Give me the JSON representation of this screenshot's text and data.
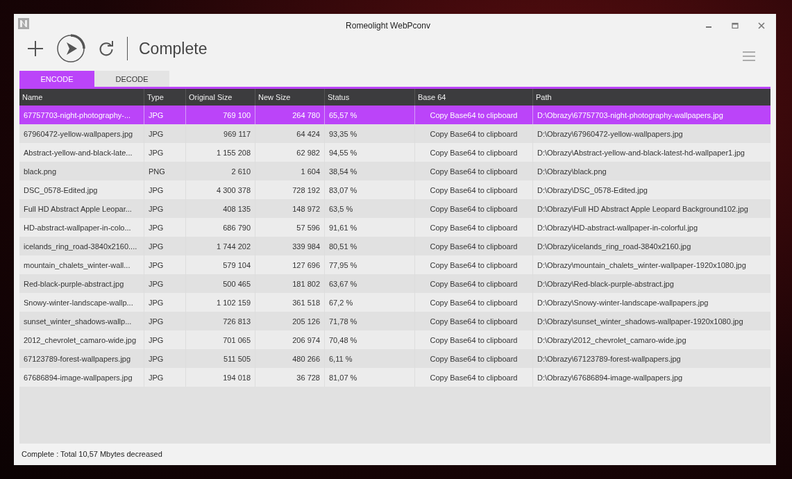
{
  "window": {
    "title": "Romeolight WebPconv"
  },
  "toolbar": {
    "status": "Complete"
  },
  "tabs": [
    {
      "label": "ENCODE",
      "selected": true
    },
    {
      "label": "DECODE",
      "selected": false
    }
  ],
  "table": {
    "columns": [
      "Name",
      "Type",
      "Original Size",
      "New Size",
      "Status",
      "Base 64",
      "Path"
    ],
    "rows": [
      {
        "name": "67757703-night-photography-...",
        "type": "JPG",
        "original_size": "769 100",
        "new_size": "264 780",
        "status": "65,57 %",
        "base64": "Copy Base64 to clipboard",
        "path": "D:\\Obrazy\\67757703-night-photography-wallpapers.jpg",
        "selected": true
      },
      {
        "name": "67960472-yellow-wallpapers.jpg",
        "type": "JPG",
        "original_size": "969 117",
        "new_size": "64 424",
        "status": "93,35 %",
        "base64": "Copy Base64 to clipboard",
        "path": "D:\\Obrazy\\67960472-yellow-wallpapers.jpg",
        "selected": false
      },
      {
        "name": "Abstract-yellow-and-black-late...",
        "type": "JPG",
        "original_size": "1 155 208",
        "new_size": "62 982",
        "status": "94,55 %",
        "base64": "Copy Base64 to clipboard",
        "path": "D:\\Obrazy\\Abstract-yellow-and-black-latest-hd-wallpaper1.jpg",
        "selected": false
      },
      {
        "name": "black.png",
        "type": "PNG",
        "original_size": "2 610",
        "new_size": "1 604",
        "status": "38,54 %",
        "base64": "Copy Base64 to clipboard",
        "path": "D:\\Obrazy\\black.png",
        "selected": false
      },
      {
        "name": "DSC_0578-Edited.jpg",
        "type": "JPG",
        "original_size": "4 300 378",
        "new_size": "728 192",
        "status": "83,07 %",
        "base64": "Copy Base64 to clipboard",
        "path": "D:\\Obrazy\\DSC_0578-Edited.jpg",
        "selected": false
      },
      {
        "name": "Full HD Abstract Apple Leopar...",
        "type": "JPG",
        "original_size": "408 135",
        "new_size": "148 972",
        "status": "63,5 %",
        "base64": "Copy Base64 to clipboard",
        "path": "D:\\Obrazy\\Full HD Abstract Apple Leopard Background102.jpg",
        "selected": false
      },
      {
        "name": "HD-abstract-wallpaper-in-colo...",
        "type": "JPG",
        "original_size": "686 790",
        "new_size": "57 596",
        "status": "91,61 %",
        "base64": "Copy Base64 to clipboard",
        "path": "D:\\Obrazy\\HD-abstract-wallpaper-in-colorful.jpg",
        "selected": false
      },
      {
        "name": "icelands_ring_road-3840x2160....",
        "type": "JPG",
        "original_size": "1 744 202",
        "new_size": "339 984",
        "status": "80,51 %",
        "base64": "Copy Base64 to clipboard",
        "path": "D:\\Obrazy\\icelands_ring_road-3840x2160.jpg",
        "selected": false
      },
      {
        "name": "mountain_chalets_winter-wall...",
        "type": "JPG",
        "original_size": "579 104",
        "new_size": "127 696",
        "status": "77,95 %",
        "base64": "Copy Base64 to clipboard",
        "path": "D:\\Obrazy\\mountain_chalets_winter-wallpaper-1920x1080.jpg",
        "selected": false
      },
      {
        "name": "Red-black-purple-abstract.jpg",
        "type": "JPG",
        "original_size": "500 465",
        "new_size": "181 802",
        "status": "63,67 %",
        "base64": "Copy Base64 to clipboard",
        "path": "D:\\Obrazy\\Red-black-purple-abstract.jpg",
        "selected": false
      },
      {
        "name": "Snowy-winter-landscape-wallp...",
        "type": "JPG",
        "original_size": "1 102 159",
        "new_size": "361 518",
        "status": "67,2 %",
        "base64": "Copy Base64 to clipboard",
        "path": "D:\\Obrazy\\Snowy-winter-landscape-wallpapers.jpg",
        "selected": false
      },
      {
        "name": "sunset_winter_shadows-wallp...",
        "type": "JPG",
        "original_size": "726 813",
        "new_size": "205 126",
        "status": "71,78 %",
        "base64": "Copy Base64 to clipboard",
        "path": "D:\\Obrazy\\sunset_winter_shadows-wallpaper-1920x1080.jpg",
        "selected": false
      },
      {
        "name": "2012_chevrolet_camaro-wide.jpg",
        "type": "JPG",
        "original_size": "701 065",
        "new_size": "206 974",
        "status": "70,48 %",
        "base64": "Copy Base64 to clipboard",
        "path": "D:\\Obrazy\\2012_chevrolet_camaro-wide.jpg",
        "selected": false
      },
      {
        "name": "67123789-forest-wallpapers.jpg",
        "type": "JPG",
        "original_size": "511 505",
        "new_size": "480 266",
        "status": "6,11 %",
        "base64": "Copy Base64 to clipboard",
        "path": "D:\\Obrazy\\67123789-forest-wallpapers.jpg",
        "selected": false
      },
      {
        "name": "67686894-image-wallpapers.jpg",
        "type": "JPG",
        "original_size": "194 018",
        "new_size": "36 728",
        "status": "81,07 %",
        "base64": "Copy Base64 to clipboard",
        "path": "D:\\Obrazy\\67686894-image-wallpapers.jpg",
        "selected": false
      }
    ]
  },
  "status_bar": "Complete : Total 10,57 Mbytes decreased"
}
